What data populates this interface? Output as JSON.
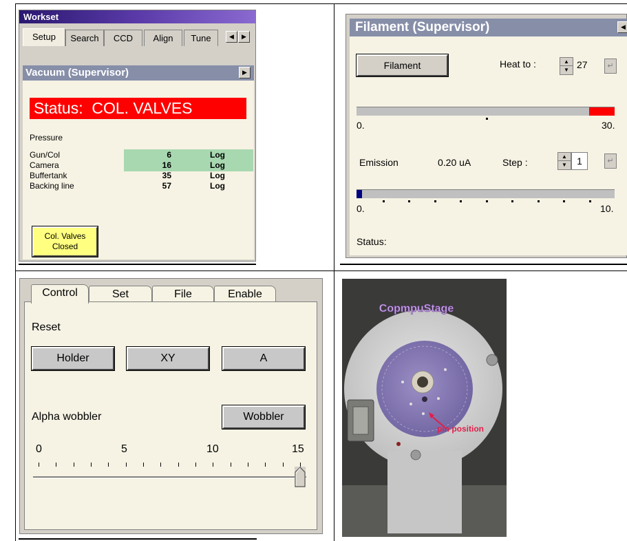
{
  "workset": {
    "title": "Workset",
    "tabs": [
      "Setup",
      "Search",
      "CCD",
      "Align",
      "Tune"
    ],
    "vacuum": {
      "title": "Vacuum (Supervisor)",
      "status": "Status:  COL. VALVES",
      "pressure_label": "Pressure",
      "rows": [
        {
          "label": "Gun/Col",
          "value": "6",
          "mode": "Log"
        },
        {
          "label": "Camera",
          "value": "16",
          "mode": "Log"
        },
        {
          "label": "Buffertank",
          "value": "35",
          "mode": "Log"
        },
        {
          "label": "Backing line",
          "value": "57",
          "mode": "Log"
        }
      ],
      "valve_button": {
        "line1": "Col. Valves",
        "line2": "Closed"
      }
    }
  },
  "filament": {
    "title": "Filament (Supervisor)",
    "button": "Filament",
    "heat_label": "Heat to :",
    "heat_value": "27",
    "heat_min": "0.",
    "heat_max": "30.",
    "heat_fraction": 0.9,
    "emission_label": "Emission",
    "emission_value": "0.20  uA",
    "step_label": "Step :",
    "step_value": "1",
    "emission_min": "0.",
    "emission_max": "10.",
    "emission_fraction": 0.02,
    "status_label": "Status:"
  },
  "control": {
    "tabs": [
      "Control",
      "Set",
      "File",
      "Enable"
    ],
    "reset_label": "Reset",
    "buttons": [
      "Holder",
      "XY",
      "A"
    ],
    "alpha_label": "Alpha wobbler",
    "wobbler_button": "Wobbler",
    "scale": [
      "0",
      "5",
      "10",
      "15"
    ],
    "slider_value": 15
  },
  "photo": {
    "title": "CopmpuStage",
    "annotation": "pin position"
  },
  "colors": {
    "status_red": "#ff0000",
    "valve_yellow": "#ffff80",
    "panel_title": "#868ea8",
    "panel_bg": "#f6f3e4",
    "heat_fill": "#ff0000",
    "emission_fill": "#000080"
  },
  "icons": [
    "tab-scroll-left-icon",
    "tab-scroll-right-icon",
    "panel-collapse-icon",
    "spin-up-icon",
    "spin-down-icon",
    "enter-icon"
  ]
}
